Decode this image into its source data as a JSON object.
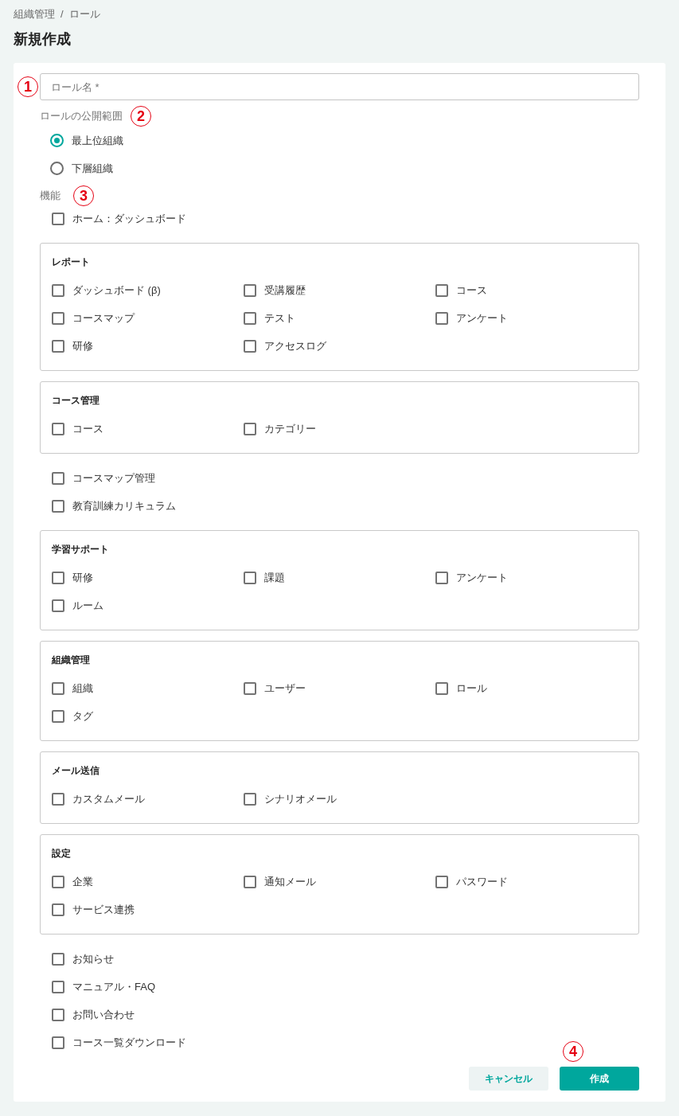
{
  "breadcrumb": {
    "items": [
      "組織管理",
      "ロール"
    ],
    "separator": "/"
  },
  "title": "新規作成",
  "name_field": {
    "placeholder": "ロール名 *",
    "annotation": "1"
  },
  "scope": {
    "label": "ロールの公開範囲",
    "annotation": "2",
    "options": [
      {
        "label": "最上位組織",
        "selected": true
      },
      {
        "label": "下層組織",
        "selected": false
      }
    ]
  },
  "features": {
    "label": "機能",
    "annotation": "3",
    "items": [
      {
        "kind": "checkbox",
        "label": "ホーム：ダッシュボード",
        "checked": false
      },
      {
        "kind": "group",
        "title": "レポート",
        "options": [
          {
            "label": "ダッシュボード (β)",
            "checked": false
          },
          {
            "label": "受講履歴",
            "checked": false
          },
          {
            "label": "コース",
            "checked": false
          },
          {
            "label": "コースマップ",
            "checked": false
          },
          {
            "label": "テスト",
            "checked": false
          },
          {
            "label": "アンケート",
            "checked": false
          },
          {
            "label": "研修",
            "checked": false
          },
          {
            "label": "アクセスログ",
            "checked": false
          }
        ]
      },
      {
        "kind": "group",
        "title": "コース管理",
        "options": [
          {
            "label": "コース",
            "checked": false
          },
          {
            "label": "カテゴリー",
            "checked": false
          }
        ]
      },
      {
        "kind": "checkbox",
        "label": "コースマップ管理",
        "checked": false
      },
      {
        "kind": "checkbox",
        "label": "教育訓練カリキュラム",
        "checked": false
      },
      {
        "kind": "group",
        "title": "学習サポート",
        "options": [
          {
            "label": "研修",
            "checked": false
          },
          {
            "label": "課題",
            "checked": false
          },
          {
            "label": "アンケート",
            "checked": false
          },
          {
            "label": "ルーム",
            "checked": false
          }
        ]
      },
      {
        "kind": "group",
        "title": "組織管理",
        "options": [
          {
            "label": "組織",
            "checked": false
          },
          {
            "label": "ユーザー",
            "checked": false
          },
          {
            "label": "ロール",
            "checked": false
          },
          {
            "label": "タグ",
            "checked": false
          }
        ]
      },
      {
        "kind": "group",
        "title": "メール送信",
        "options": [
          {
            "label": "カスタムメール",
            "checked": false
          },
          {
            "label": "シナリオメール",
            "checked": false
          }
        ]
      },
      {
        "kind": "group",
        "title": "設定",
        "options": [
          {
            "label": "企業",
            "checked": false
          },
          {
            "label": "通知メール",
            "checked": false
          },
          {
            "label": "パスワード",
            "checked": false
          },
          {
            "label": "サービス連携",
            "checked": false
          }
        ]
      },
      {
        "kind": "checkbox",
        "label": "お知らせ",
        "checked": false
      },
      {
        "kind": "checkbox",
        "label": "マニュアル・FAQ",
        "checked": false
      },
      {
        "kind": "checkbox",
        "label": "お問い合わせ",
        "checked": false
      },
      {
        "kind": "checkbox",
        "label": "コース一覧ダウンロード",
        "checked": false
      }
    ]
  },
  "actions": {
    "annotation": "4",
    "buttons": [
      {
        "kind": "secondary",
        "label": "キャンセル"
      },
      {
        "kind": "primary",
        "label": "作成"
      }
    ]
  }
}
